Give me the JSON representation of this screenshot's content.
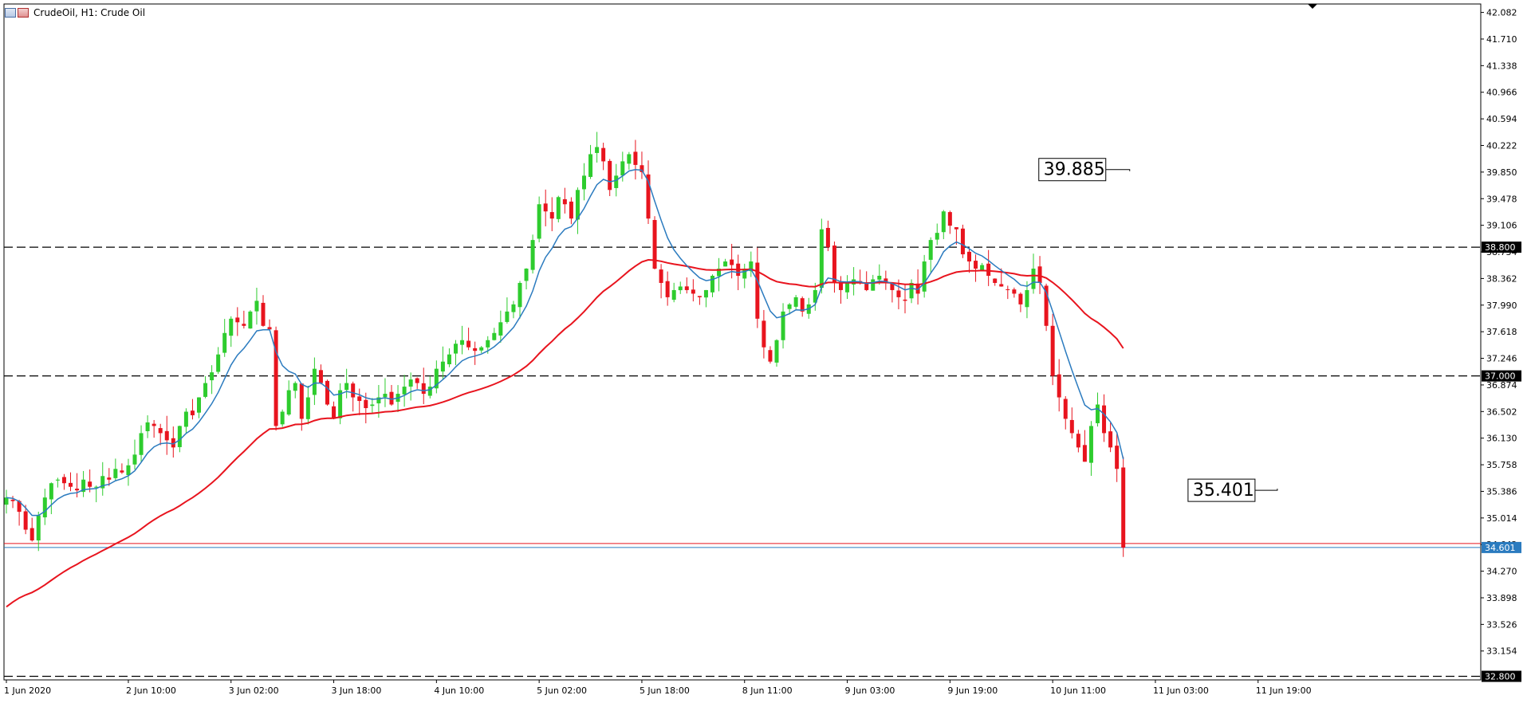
{
  "header": {
    "title": "CrudeOil, H1:  Crude Oil"
  },
  "colors": {
    "bull": "#2ecc2e",
    "bear": "#e8141e",
    "ma_fast": "#2b7bbf",
    "ma_slow": "#e8141e",
    "level_line": "#000000",
    "bid_line": "#e8141e",
    "ask_line": "#2b7bbf"
  },
  "chart_data": {
    "type": "candlestick",
    "symbol": "CrudeOil",
    "timeframe": "H1",
    "ylim": [
      32.75,
      42.2
    ],
    "y_ticks": [
      "42.082",
      "41.710",
      "41.338",
      "40.966",
      "40.594",
      "40.222",
      "39.850",
      "39.478",
      "39.106",
      "38.734",
      "38.362",
      "37.990",
      "37.618",
      "37.246",
      "36.874",
      "36.502",
      "36.130",
      "35.758",
      "35.386",
      "35.014",
      "34.642",
      "34.270",
      "33.898",
      "33.526",
      "33.154"
    ],
    "x_labels": [
      {
        "label": "1 Jun 2020",
        "index": 0
      },
      {
        "label": "2 Jun 10:00",
        "index": 19
      },
      {
        "label": "3 Jun 02:00",
        "index": 35
      },
      {
        "label": "3 Jun 18:00",
        "index": 51
      },
      {
        "label": "4 Jun 10:00",
        "index": 67
      },
      {
        "label": "5 Jun 02:00",
        "index": 83
      },
      {
        "label": "5 Jun 18:00",
        "index": 99
      },
      {
        "label": "8 Jun 11:00",
        "index": 115
      },
      {
        "label": "9 Jun 03:00",
        "index": 131
      },
      {
        "label": "9 Jun 19:00",
        "index": 147
      },
      {
        "label": "10 Jun 11:00",
        "index": 163
      },
      {
        "label": "11 Jun 03:00",
        "index": 179
      },
      {
        "label": "11 Jun 19:00",
        "index": 195
      }
    ],
    "horizontal_levels": [
      {
        "value": 38.8,
        "label": "38.800"
      },
      {
        "value": 37.0,
        "label": "37.000"
      },
      {
        "value": 32.8,
        "label": "32.800"
      }
    ],
    "bid_price": 34.601,
    "bid_label": "34.601",
    "annotations": [
      {
        "label": "39.885",
        "value": 39.885,
        "index": 175
      },
      {
        "label": "35.401",
        "value": 35.401,
        "index": 198
      }
    ],
    "close_path": [
      35.3,
      35.25,
      35.1,
      34.85,
      34.7,
      35.05,
      35.3,
      35.5,
      35.55,
      35.5,
      35.45,
      35.4,
      35.55,
      35.45,
      35.45,
      35.6,
      35.55,
      35.7,
      35.65,
      35.75,
      35.9,
      36.2,
      36.35,
      36.3,
      36.2,
      36.1,
      36.0,
      36.3,
      36.5,
      36.45,
      36.7,
      36.9,
      37.05,
      37.3,
      37.6,
      37.8,
      37.75,
      37.7,
      37.9,
      38.05,
      37.7,
      37.65,
      36.3,
      36.5,
      36.8,
      36.9,
      36.4,
      36.7,
      37.1,
      36.9,
      36.6,
      36.4,
      36.8,
      36.9,
      36.7,
      36.65,
      36.55,
      36.6,
      36.7,
      36.75,
      36.6,
      36.75,
      36.85,
      36.95,
      36.9,
      36.75,
      36.85,
      37.1,
      37.2,
      37.3,
      37.45,
      37.5,
      37.4,
      37.35,
      37.4,
      37.5,
      37.6,
      37.75,
      37.9,
      38.0,
      38.3,
      38.5,
      38.9,
      39.4,
      39.3,
      39.2,
      39.5,
      39.4,
      39.2,
      39.6,
      39.8,
      40.1,
      40.2,
      40.0,
      39.6,
      39.8,
      40.0,
      40.1,
      39.95,
      39.85,
      39.2,
      38.5,
      38.3,
      38.1,
      38.2,
      38.25,
      38.2,
      38.15,
      38.1,
      38.2,
      38.4,
      38.5,
      38.6,
      38.55,
      38.4,
      38.5,
      38.6,
      37.8,
      37.4,
      37.2,
      37.5,
      37.9,
      38.0,
      38.1,
      37.9,
      38.0,
      38.2,
      39.05,
      38.8,
      38.3,
      38.2,
      38.3,
      38.35,
      38.3,
      38.2,
      38.35,
      38.4,
      38.3,
      38.2,
      38.1,
      38.05,
      38.3,
      38.15,
      38.6,
      38.9,
      39.0,
      39.3,
      39.1,
      39.05,
      38.7,
      38.6,
      38.5,
      38.55,
      38.4,
      38.3,
      38.25,
      38.2,
      38.15,
      38.0,
      38.2,
      38.5,
      38.3,
      37.7,
      37.0,
      36.7,
      36.4,
      36.2,
      36.0,
      35.8,
      36.3,
      36.6,
      36.2,
      36.0,
      35.7,
      34.6
    ],
    "ma_fast_period_note": "",
    "series": [
      {
        "key": "ma_fast",
        "smoothing": 0.23
      },
      {
        "key": "ma_slow",
        "smoothing": 0.045
      }
    ]
  }
}
